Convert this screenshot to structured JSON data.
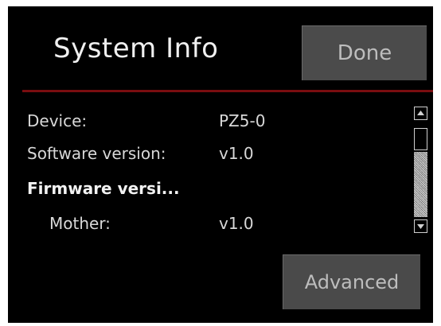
{
  "header": {
    "title": "System Info",
    "done_label": "Done"
  },
  "info_rows": [
    {
      "label": "Device:",
      "value": "PZ5-0"
    },
    {
      "label": "Software version:",
      "value": "v1.0"
    },
    {
      "label": "Firmware versi...",
      "value": ""
    },
    {
      "label": "Mother:",
      "value": "v1.0"
    }
  ],
  "footer": {
    "advanced_label": "Advanced"
  },
  "icons": {
    "scroll_up": "up-arrow-icon",
    "scroll_down": "down-arrow-icon"
  },
  "colors": {
    "background": "#000000",
    "divider": "#7a0d10",
    "button_bg": "#4a4a4a",
    "button_text": "#bdbdbd",
    "text": "#d8d8d8"
  }
}
